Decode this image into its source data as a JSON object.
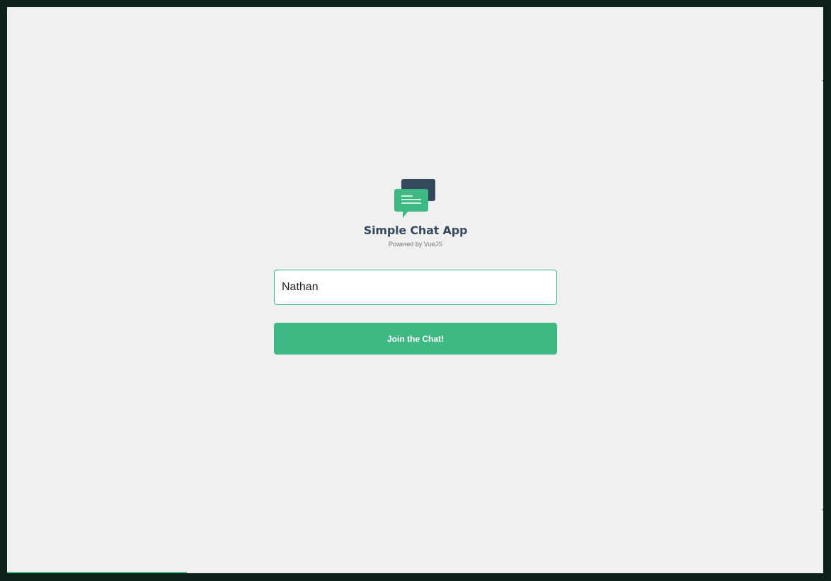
{
  "app": {
    "title": "Simple Chat App",
    "subtitle": "Powered by VueJS",
    "logo_icon": "chat-bubbles-icon"
  },
  "login_form": {
    "name_value": "Nathan",
    "join_label": "Join the Chat!"
  },
  "colors": {
    "accent": "#3fb984",
    "dark": "#35495e",
    "background": "#f0f0f0",
    "frame": "#0c2218"
  },
  "loading_progress": 0.22
}
